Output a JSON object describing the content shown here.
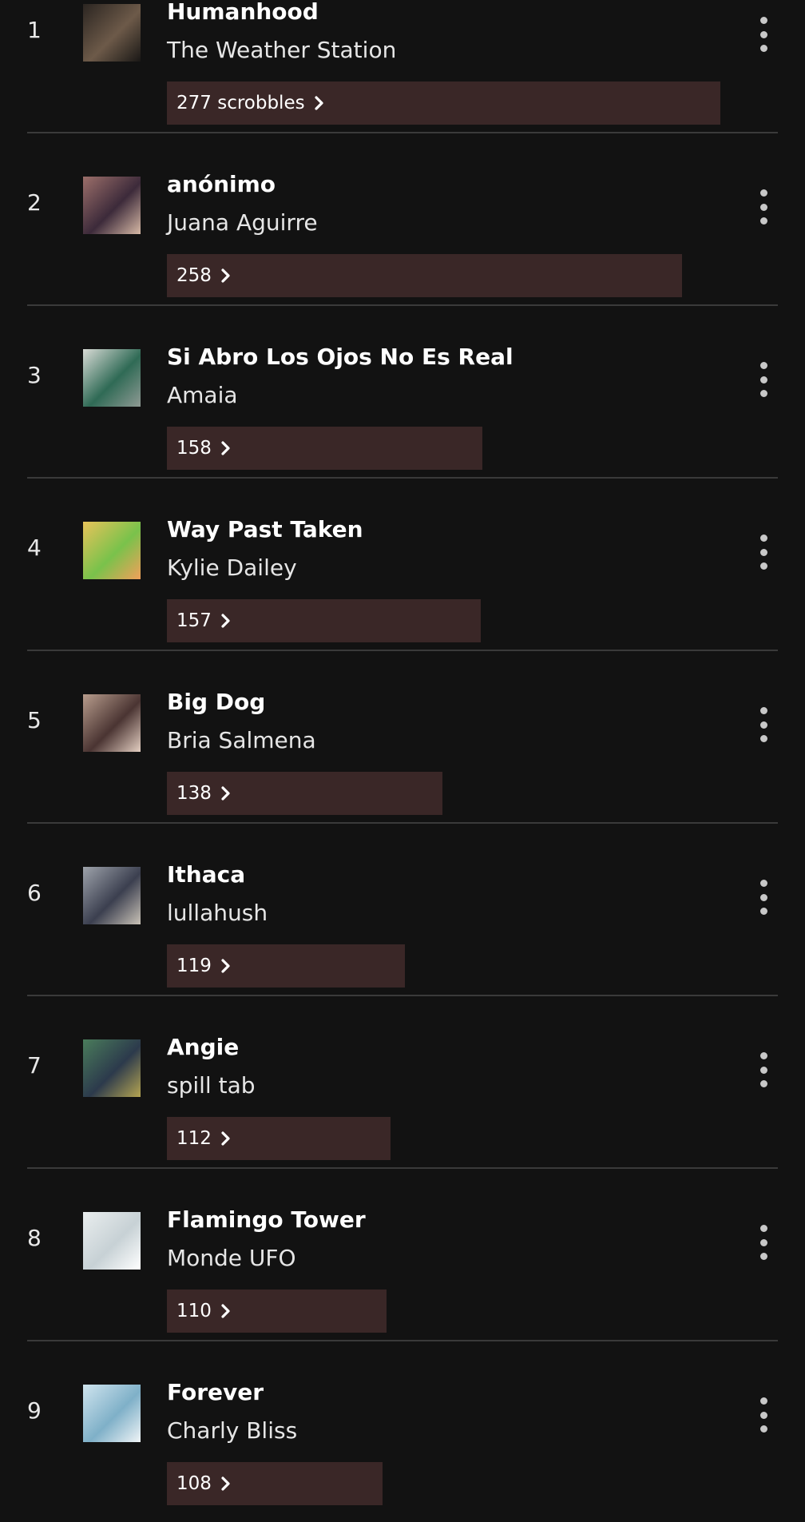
{
  "colors": {
    "background": "#121212",
    "bar": "#3a2727",
    "divider": "#3a3a3a"
  },
  "tracks": [
    {
      "rank": "1",
      "title": "Humanhood",
      "artist": "The Weather Station",
      "scrobbles_label": "277 scrobbles",
      "scrobbles": 277,
      "art_colors": [
        "#2b2521",
        "#6d5a49",
        "#1a1816"
      ]
    },
    {
      "rank": "2",
      "title": "anónimo",
      "artist": "Juana Aguirre",
      "scrobbles_label": "258",
      "scrobbles": 258,
      "art_colors": [
        "#9c6f6a",
        "#3c2a3a",
        "#d7b9a6"
      ]
    },
    {
      "rank": "3",
      "title": "Si Abro Los Ojos No Es Real",
      "artist": "Amaia",
      "scrobbles_label": "158",
      "scrobbles": 158,
      "art_colors": [
        "#d9dbd6",
        "#2f6a55",
        "#8f9a94"
      ]
    },
    {
      "rank": "4",
      "title": "Way Past Taken",
      "artist": "Kylie Dailey",
      "scrobbles_label": "157",
      "scrobbles": 157,
      "art_colors": [
        "#e8c35a",
        "#79c24b",
        "#f2a05a"
      ]
    },
    {
      "rank": "5",
      "title": "Big Dog",
      "artist": "Bria Salmena",
      "scrobbles_label": "138",
      "scrobbles": 138,
      "art_colors": [
        "#b89d8d",
        "#4a3432",
        "#e4cfc2"
      ]
    },
    {
      "rank": "6",
      "title": "Ithaca",
      "artist": "lullahush",
      "scrobbles_label": "119",
      "scrobbles": 119,
      "art_colors": [
        "#9ea3ab",
        "#3b3f4f",
        "#c9c2b7"
      ]
    },
    {
      "rank": "7",
      "title": "Angie",
      "artist": "spill tab",
      "scrobbles_label": "112",
      "scrobbles": 112,
      "art_colors": [
        "#4a7c5b",
        "#2c3a4c",
        "#b5a552"
      ]
    },
    {
      "rank": "8",
      "title": "Flamingo Tower",
      "artist": "Monde UFO",
      "scrobbles_label": "110",
      "scrobbles": 110,
      "art_colors": [
        "#e9edee",
        "#c7d1d5",
        "#ffffff"
      ]
    },
    {
      "rank": "9",
      "title": "Forever",
      "artist": "Charly Bliss",
      "scrobbles_label": "108",
      "scrobbles": 108,
      "art_colors": [
        "#cfe4ee",
        "#7fb0c8",
        "#f0f4f6"
      ]
    }
  ]
}
